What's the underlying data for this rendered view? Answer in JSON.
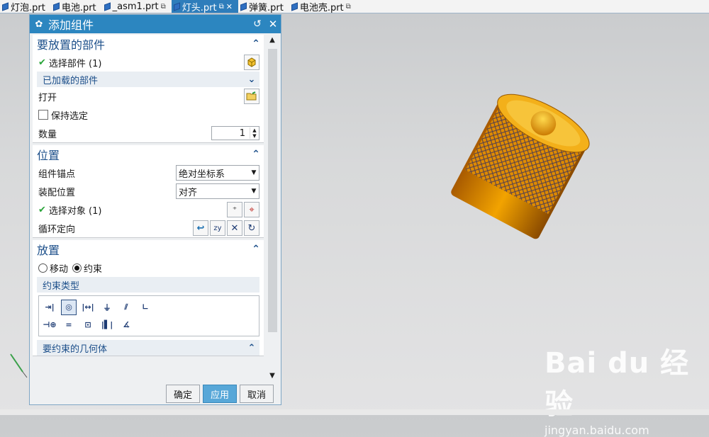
{
  "tabs": [
    {
      "label": "灯泡.prt",
      "active": false
    },
    {
      "label": "电池.prt",
      "active": false
    },
    {
      "label": "_asm1.prt",
      "active": false
    },
    {
      "label": "灯头.prt",
      "active": true
    },
    {
      "label": "弹簧.prt",
      "active": false
    },
    {
      "label": "电池壳.prt",
      "active": false
    }
  ],
  "dialog": {
    "title": "添加组件",
    "parts": {
      "header": "要放置的部件",
      "select_part": "选择部件 (1)",
      "loaded_parts": "已加载的部件",
      "open": "打开",
      "keep_selection": "保持选定",
      "quantity_label": "数量",
      "quantity_value": "1"
    },
    "position": {
      "header": "位置",
      "anchor_label": "组件锚点",
      "anchor_value": "绝对坐标系",
      "assembly_pos_label": "装配位置",
      "assembly_pos_value": "对齐",
      "select_object": "选择对象 (1)",
      "cycle_orient": "循环定向"
    },
    "placement": {
      "header": "放置",
      "move": "移动",
      "constraint": "约束",
      "selected_mode": "约束",
      "constraint_type": "约束类型",
      "constraint_geometry": "要约束的几何体"
    },
    "buttons": {
      "ok": "确定",
      "apply": "应用",
      "cancel": "取消"
    }
  },
  "watermark": {
    "brand": "Bai du 经验",
    "url": "jingyan.baidu.com"
  },
  "colors": {
    "title_bar": "#2c86c0",
    "active_tab": "#2e7dbb",
    "part_gold": "#f0a000",
    "apply_button": "#57a7d8"
  }
}
